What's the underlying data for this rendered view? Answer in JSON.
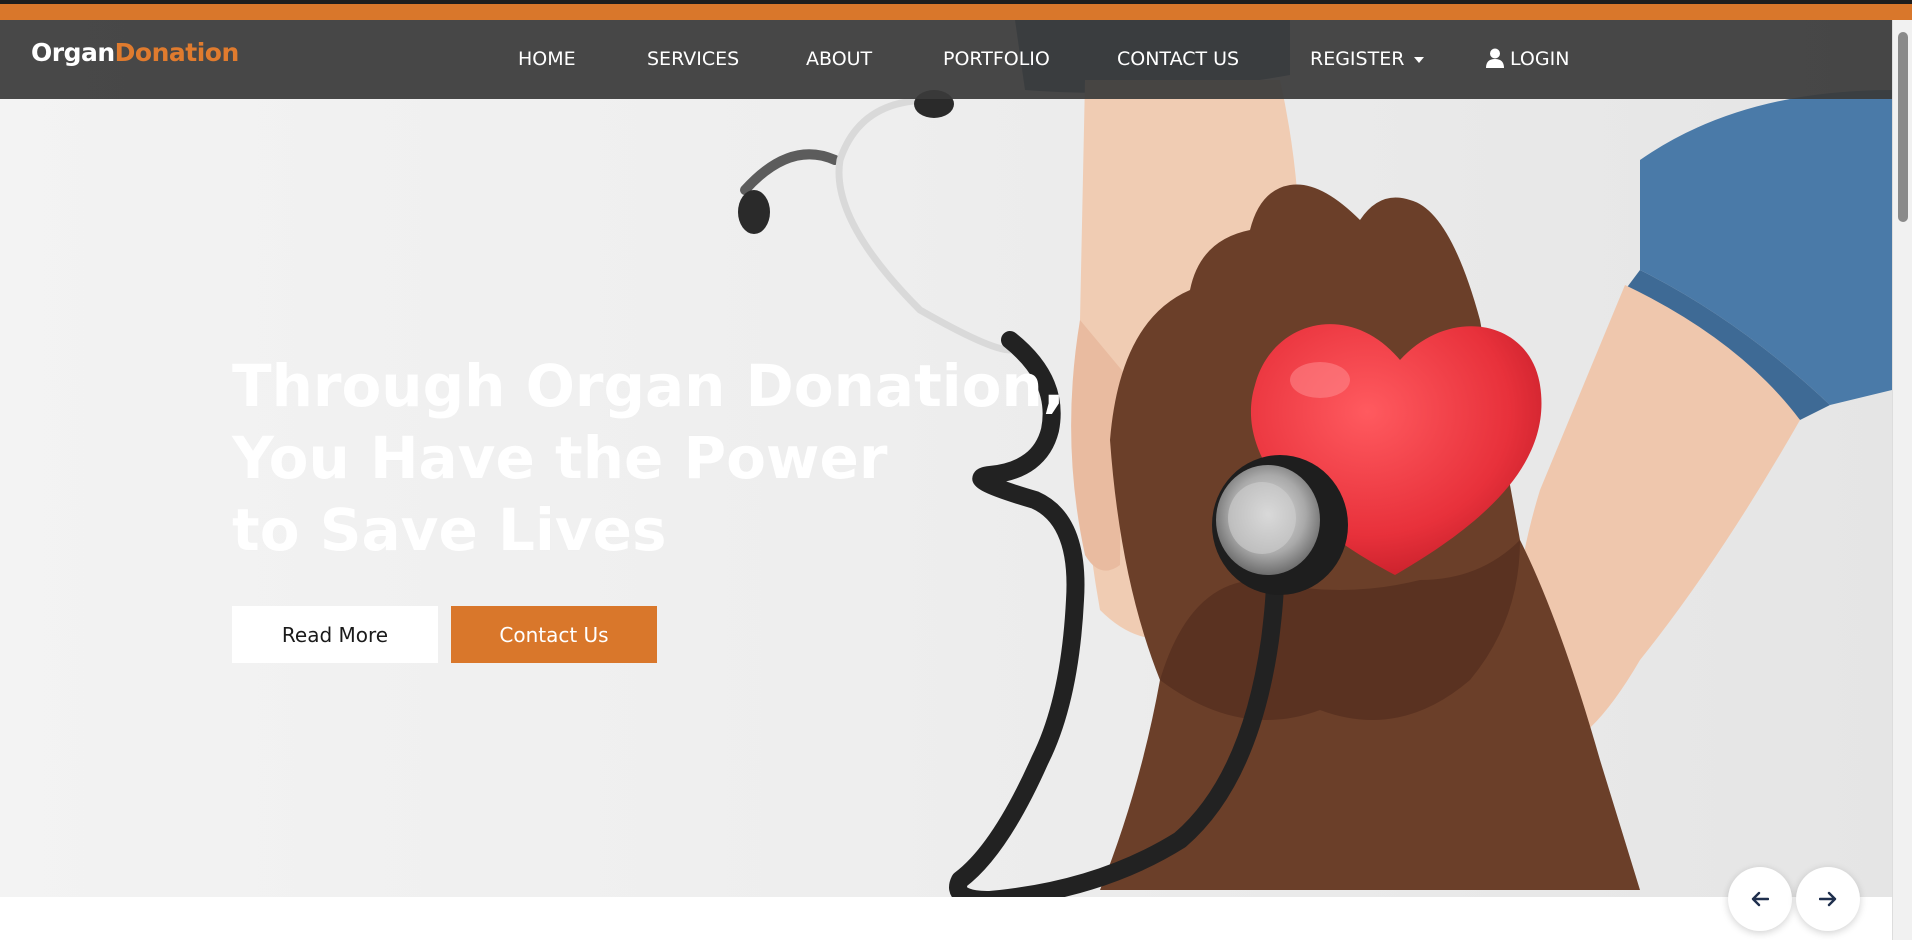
{
  "brand": {
    "part1": "Organ",
    "part2": "Donation"
  },
  "nav": {
    "home": "HOME",
    "services": "SERVICES",
    "about": "ABOUT",
    "portfolio": "PORTFOLIO",
    "contact": "CONTACT US",
    "register": "REGISTER",
    "login": "LOGIN"
  },
  "hero": {
    "title_line1": "Through Organ Donation,",
    "title_line2": "You Have the Power",
    "title_line3": "to Save Lives",
    "read_more": "Read More",
    "contact_us": "Contact Us"
  },
  "carousel": {
    "prev_icon": "arrow-left-icon",
    "next_icon": "arrow-right-icon"
  },
  "colors": {
    "accent": "#d9772b",
    "navbar": "#3a3a3a",
    "heart": "#e8313b"
  }
}
